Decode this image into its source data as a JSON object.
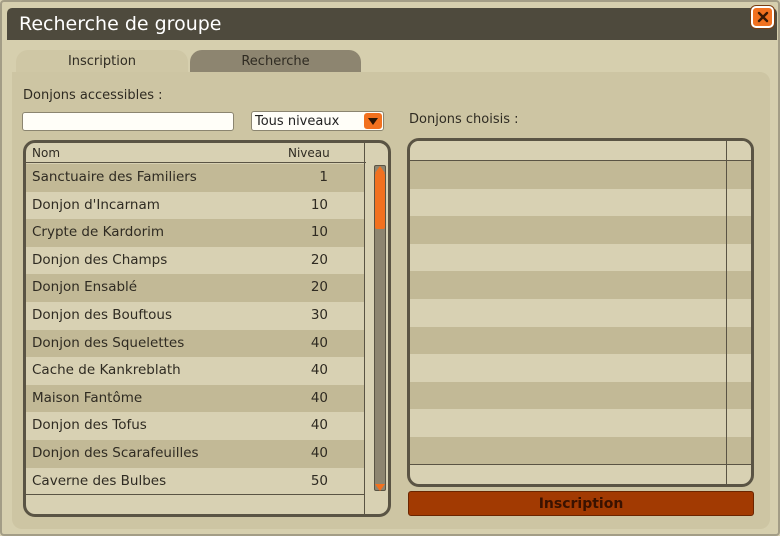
{
  "window": {
    "title": "Recherche de groupe",
    "close_icon": "close-x-icon"
  },
  "tabs": [
    {
      "label": "Inscription",
      "active": true
    },
    {
      "label": "Recherche",
      "active": false
    }
  ],
  "left": {
    "label": "Donjons accessibles :",
    "search": {
      "value": "",
      "placeholder": ""
    },
    "level_select": {
      "value": "Tous niveaux",
      "icon": "dropdown-arrow-icon"
    },
    "columns": {
      "name": "Nom",
      "level": "Niveau"
    },
    "rows": [
      {
        "name": "Sanctuaire des Familiers",
        "level": "1"
      },
      {
        "name": "Donjon d'Incarnam",
        "level": "10"
      },
      {
        "name": "Crypte de Kardorim",
        "level": "10"
      },
      {
        "name": "Donjon des Champs",
        "level": "20"
      },
      {
        "name": "Donjon Ensablé",
        "level": "20"
      },
      {
        "name": "Donjon des Bouftous",
        "level": "30"
      },
      {
        "name": "Donjon des Squelettes",
        "level": "40"
      },
      {
        "name": "Cache de Kankreblath",
        "level": "40"
      },
      {
        "name": "Maison Fantôme",
        "level": "40"
      },
      {
        "name": "Donjon des Tofus",
        "level": "40"
      },
      {
        "name": "Donjon des Scarafeuilles",
        "level": "40"
      },
      {
        "name": "Caverne des Bulbes",
        "level": "50"
      }
    ]
  },
  "right": {
    "label": "Donjons choisis :",
    "button_label": "Inscription"
  },
  "colors": {
    "accent": "#f2711f",
    "button": "#a23a02",
    "titlebar": "#4e4a3d",
    "panel": "#cdc5a3"
  }
}
